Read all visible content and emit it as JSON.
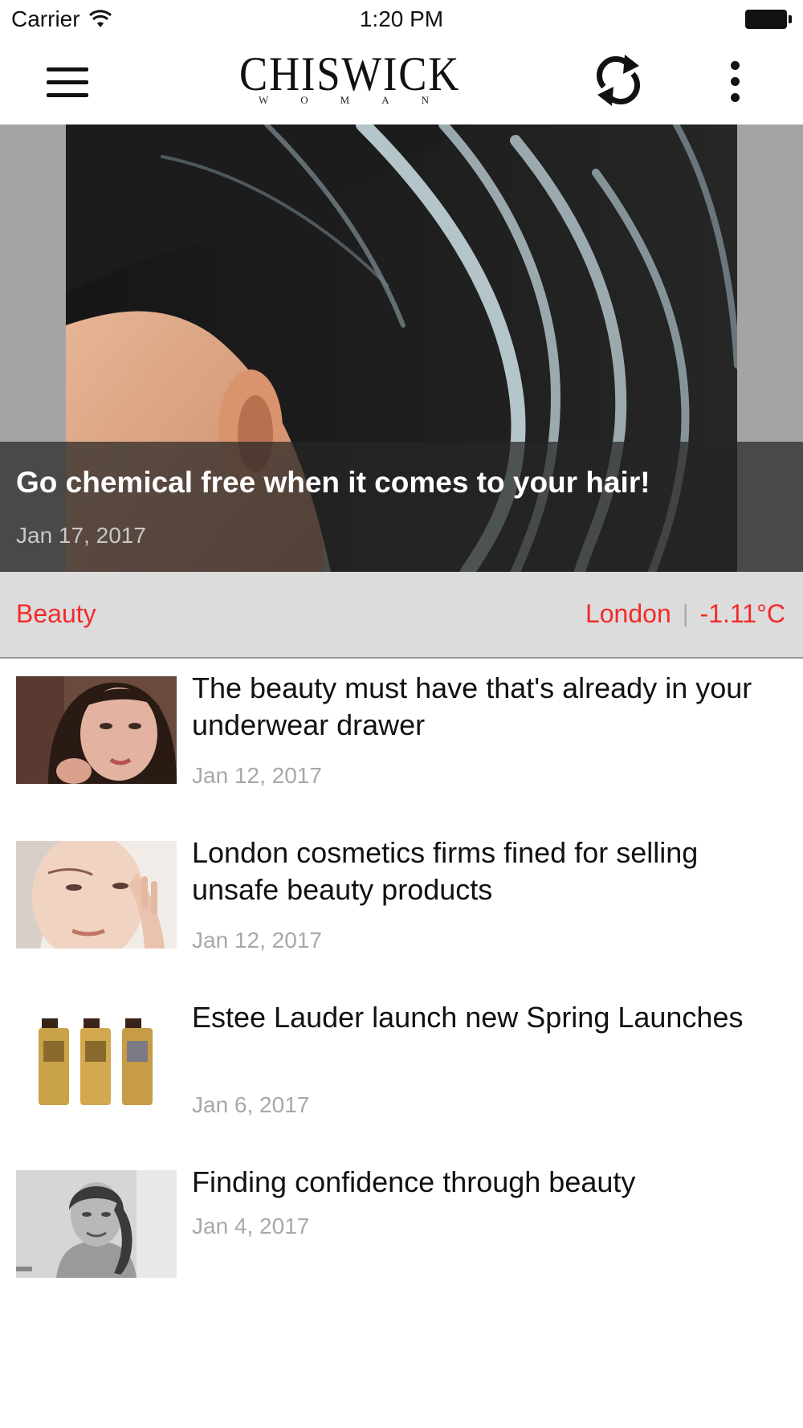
{
  "status_bar": {
    "carrier": "Carrier",
    "time": "1:20 PM"
  },
  "nav": {
    "logo_main": "CHISWICK",
    "logo_sub": "WOMAN",
    "icons": [
      "menu-icon",
      "refresh-icon",
      "more-vertical-icon"
    ]
  },
  "hero": {
    "title": "Go chemical free when it comes to your hair!",
    "date": "Jan 17, 2017"
  },
  "category_bar": {
    "category": "Beauty",
    "city": "London",
    "separator": "|",
    "temperature": "-1.11°C",
    "accent_color": "#f42a2a"
  },
  "articles": [
    {
      "title": "The beauty must have that's already in your underwear drawer",
      "date": "Jan 12, 2017"
    },
    {
      "title": "London cosmetics firms fined for selling unsafe beauty products",
      "date": "Jan 12, 2017"
    },
    {
      "title": "Estee Lauder launch new Spring Launches",
      "date": "Jan 6, 2017"
    },
    {
      "title": "Finding confidence through beauty",
      "date": "Jan 4, 2017"
    }
  ]
}
